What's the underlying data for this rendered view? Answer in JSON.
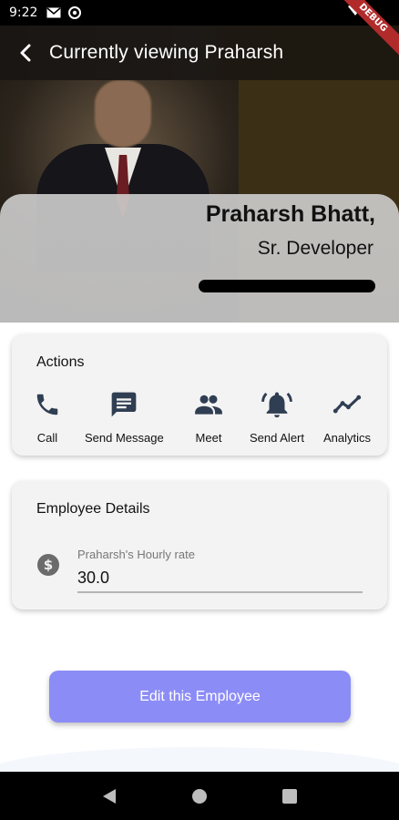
{
  "status_bar": {
    "time": "9:22",
    "debug_label": "DEBUG"
  },
  "app_bar": {
    "title": "Currently viewing Praharsh"
  },
  "profile": {
    "name": "Praharsh Bhatt,",
    "role": "Sr. Developer",
    "email_redacted": true
  },
  "actions": {
    "title": "Actions",
    "items": [
      {
        "label": "Call",
        "icon": "phone-icon"
      },
      {
        "label": "Send Message",
        "icon": "message-icon"
      },
      {
        "label": "Meet",
        "icon": "people-icon"
      },
      {
        "label": "Send Alert",
        "icon": "bell-alert-icon"
      },
      {
        "label": "Analytics",
        "icon": "trend-icon"
      }
    ]
  },
  "details": {
    "title": "Employee Details",
    "hourly_rate_label": "Praharsh's Hourly rate",
    "hourly_rate_value": "30.0"
  },
  "edit_button_label": "Edit this Employee",
  "colors": {
    "accent": "#8c8cf7",
    "icon": "#2f3e52",
    "card": "#f3f3f3"
  }
}
